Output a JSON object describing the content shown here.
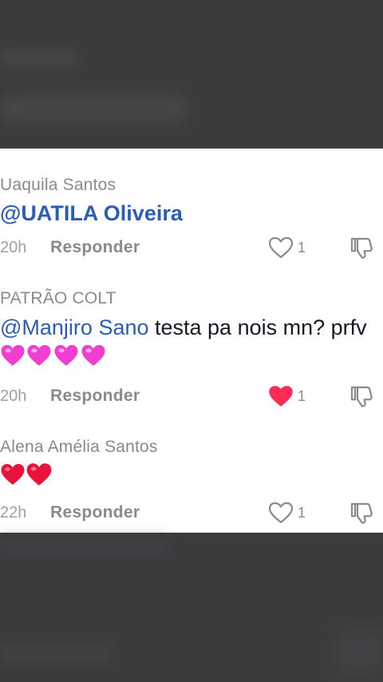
{
  "comments": [
    {
      "author": "Uaquila Santos",
      "mention": "@UATILA Oliveira",
      "text": "",
      "time": "20h",
      "reply_label": "Responder",
      "likes": "1",
      "liked": false
    },
    {
      "author": "PATRÃO COLT",
      "mention": "@Manjiro Sano",
      "text": " testa pa nois mn? prfv",
      "emojis": [
        "pink-sparkling-heart",
        "pink-sparkling-heart",
        "pink-sparkling-heart",
        "pink-sparkling-heart"
      ],
      "time": "20h",
      "reply_label": "Responder",
      "likes": "1",
      "liked": true
    },
    {
      "author": "Alena Amélia Santos",
      "mention": "",
      "text": "",
      "emojis": [
        "red-heart",
        "red-heart"
      ],
      "time": "22h",
      "reply_label": "Responder",
      "likes": "1",
      "liked": false
    }
  ],
  "colors": {
    "mention": "#2b5db8",
    "liked_heart": "#fe2c55",
    "author": "#8a8a8e",
    "body_text": "#161823",
    "overlay": "#3b3b3d"
  },
  "icons": {
    "like": "heart-outline-icon",
    "liked": "heart-filled-icon",
    "dislike": "thumbs-down-icon"
  }
}
